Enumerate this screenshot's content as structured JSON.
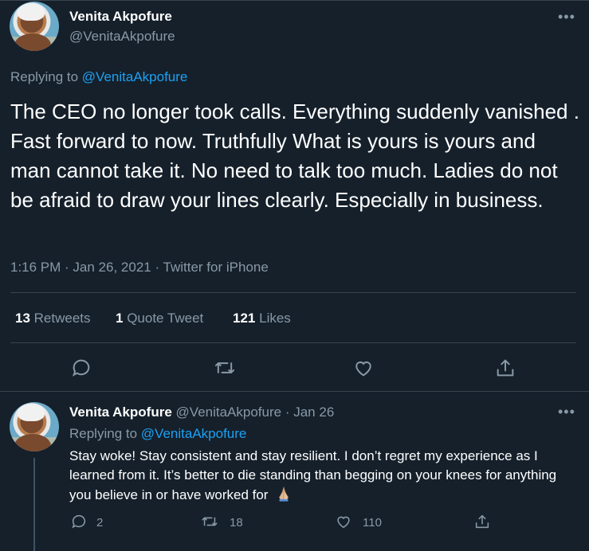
{
  "tweet": {
    "author_name": "Venita Akpofure",
    "author_handle": "@VenitaAkpofure",
    "replying_prefix": "Replying to",
    "replying_handle": "@VenitaAkpofure",
    "text": "The CEO no longer took calls. Everything suddenly vanished . Fast forward to now. Truthfully What is yours is yours and man cannot take it. No need to talk too much. Ladies do not be afraid to draw your lines clearly. Especially in business.",
    "meta": "1:16 PM · Jan 26, 2021 · Twitter for iPhone",
    "stats": {
      "retweets_count": "13",
      "retweets_label": "Retweets",
      "quotes_count": "1",
      "quotes_label": "Quote Tweet",
      "likes_count": "121",
      "likes_label": "Likes"
    },
    "more_icon": "more-icon",
    "actions": [
      "reply-icon",
      "retweet-icon",
      "like-icon",
      "share-icon"
    ]
  },
  "reply": {
    "author_name": "Venita Akpofure",
    "author_handle": "@VenitaAkpofure",
    "date": "· Jan 26",
    "replying_prefix": "Replying to",
    "replying_handle": "@VenitaAkpofure",
    "text": "Stay woke! Stay consistent and stay resilient. I don’t regret my experience as I learned from it. It’s better to die standing than begging on your knees for anything you believe in or have worked for",
    "emoji": "praying-hands",
    "reply_count": "2",
    "retweet_count": "18",
    "like_count": "110"
  },
  "colors": {
    "background": "#15202b",
    "text_secondary": "#8899a6",
    "link": "#1da1f2",
    "divider": "#38444d"
  }
}
